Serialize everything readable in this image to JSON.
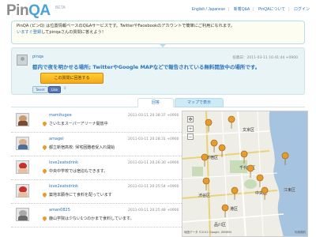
{
  "header": {
    "logo_main": "PinQA",
    "logo_beta": "BETA",
    "nav": [
      "English / Japanese",
      "新着Q&A",
      "PinQAについて",
      "ログイン"
    ]
  },
  "banner": {
    "line1": "PinQA (ピンQ) は位置情報ベースのQ&Aサービスです。TwitterやFacebookのアカウントで簡単にご利用になれます。",
    "line2_link": "いますぐ登録",
    "line2_rest": "してpinqaさんの質問に答えよう！"
  },
  "question": {
    "user": "pinqa",
    "date": "投稿日：2011-03-11 16:41:44 +0900",
    "text": "都内で夜を明かせる場所; TwitterやGoogle MAPなどで報告されている無料開放中の場所です。",
    "answer_button": "この質問に回答する",
    "tweet_label": "Tweet",
    "like_label": "Like",
    "like_count": "0"
  },
  "tabs": {
    "list": "回答",
    "map": "マップで表示"
  },
  "answers": [
    {
      "user": "mamitugee",
      "text": "さいたまスーパーアリーナ開放中",
      "date": "2011-03-11 20:38:37 +0900",
      "colors": [
        "#c79b6f",
        "#7a4b2a"
      ]
    },
    {
      "user": "amagel",
      "text": "都立新宿高校: 帰宅困難者受入れ開始",
      "date": "2011-03-11 20:28:31 +0900",
      "colors": [
        "#d9b18b",
        "#4b6f9a"
      ]
    },
    {
      "user": "love2eatsdrink",
      "text": "中央中学校では宿泊もできます。",
      "date": "2011-03-11 20:26:30 +0900",
      "colors": [
        "#c9302c",
        "#e6c1a0"
      ]
    },
    {
      "user": "love2eatsdrink",
      "text": "築地本願寺にて食料を配っています",
      "date": "2011-03-11 20:25:54 +0900",
      "colors": [
        "#c9302c",
        "#e6c1a0"
      ]
    },
    {
      "user": "aman0825",
      "text": "鹿山学院は少ない1つのかまで食料しています。",
      "date": "2011-03-11 20:25:48 +0900",
      "colors": [
        "#a9a9a9",
        "#6a6a6a"
      ]
    }
  ],
  "map": {
    "labels": [
      "文京区",
      "新宿区",
      "千代田区",
      "渋谷区",
      "中央区",
      "港区",
      "品川区",
      "江東区"
    ],
    "copyright": "地図データ ©2011 Google, ZENRIN",
    "terms": "利用規約"
  }
}
